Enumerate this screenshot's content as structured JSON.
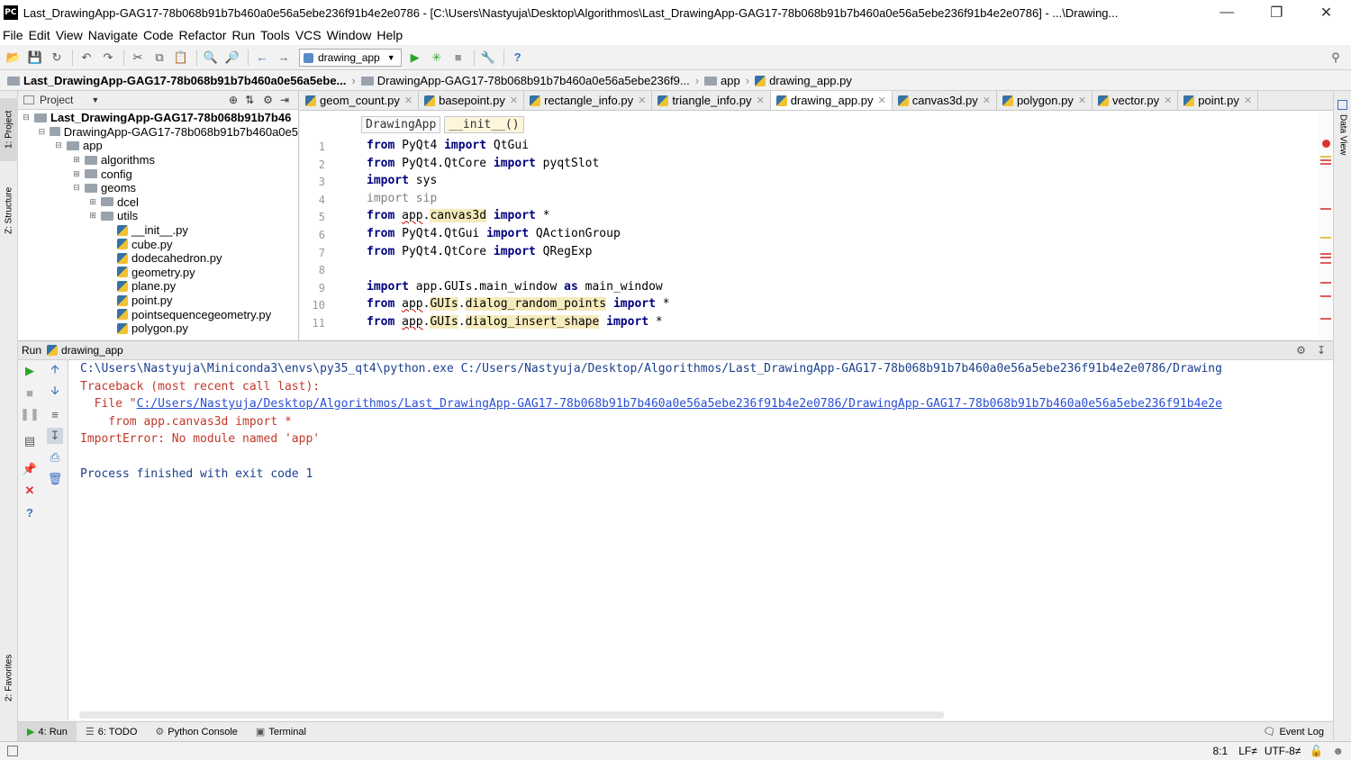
{
  "window": {
    "title": "Last_DrawingApp-GAG17-78b068b91b7b460a0e56a5ebe236f91b4e2e0786 - [C:\\Users\\Nastyuja\\Desktop\\Algorithmos\\Last_DrawingApp-GAG17-78b068b91b7b460a0e56a5ebe236f91b4e2e0786] - ...\\Drawing...",
    "app_icon": "PC"
  },
  "menu": [
    "File",
    "Edit",
    "View",
    "Navigate",
    "Code",
    "Refactor",
    "Run",
    "Tools",
    "VCS",
    "Window",
    "Help"
  ],
  "toolbar": {
    "run_config": "drawing_app"
  },
  "nav_breadcrumbs": [
    "Last_DrawingApp-GAG17-78b068b91b7b460a0e56a5ebe...",
    "DrawingApp-GAG17-78b068b91b7b460a0e56a5ebe236f9...",
    "app",
    "drawing_app.py"
  ],
  "side_tabs": {
    "project": "1: Project",
    "structure": "Z: Structure",
    "favorites": "2: Favorites",
    "data_view": "Data View"
  },
  "project_panel": {
    "header": "Project",
    "tree": [
      {
        "label": "Last_DrawingApp-GAG17-78b068b91b7b46",
        "type": "folder",
        "bold": true
      },
      {
        "label": "DrawingApp-GAG17-78b068b91b7b460a0e5",
        "type": "folder"
      },
      {
        "label": "app",
        "type": "folder"
      },
      {
        "label": "algorithms",
        "type": "folder"
      },
      {
        "label": "config",
        "type": "folder"
      },
      {
        "label": "geoms",
        "type": "folder"
      },
      {
        "label": "dcel",
        "type": "folder"
      },
      {
        "label": "utils",
        "type": "folder"
      },
      {
        "label": "__init__.py",
        "type": "py"
      },
      {
        "label": "cube.py",
        "type": "py"
      },
      {
        "label": "dodecahedron.py",
        "type": "py"
      },
      {
        "label": "geometry.py",
        "type": "py"
      },
      {
        "label": "plane.py",
        "type": "py"
      },
      {
        "label": "point.py",
        "type": "py"
      },
      {
        "label": "pointsequencegeometry.py",
        "type": "py"
      },
      {
        "label": "polygon.py",
        "type": "py"
      }
    ]
  },
  "editor_tabs": [
    {
      "label": "geom_count.py",
      "active": false
    },
    {
      "label": "basepoint.py",
      "active": false
    },
    {
      "label": "rectangle_info.py",
      "active": false
    },
    {
      "label": "triangle_info.py",
      "active": false
    },
    {
      "label": "drawing_app.py",
      "active": true
    },
    {
      "label": "canvas3d.py",
      "active": false
    },
    {
      "label": "polygon.py",
      "active": false
    },
    {
      "label": "vector.py",
      "active": false
    },
    {
      "label": "point.py",
      "active": false
    }
  ],
  "editor_breadcrumb": [
    "DrawingApp",
    "__init__()"
  ],
  "code_lines": [
    {
      "n": "1",
      "t": [
        [
          "kw",
          "from"
        ],
        [
          "",
          " PyQt4 "
        ],
        [
          "kw",
          "import"
        ],
        [
          "",
          " QtGui"
        ]
      ]
    },
    {
      "n": "2",
      "t": [
        [
          "kw",
          "from"
        ],
        [
          "",
          " PyQt4.QtCore "
        ],
        [
          "kw",
          "import"
        ],
        [
          "",
          " pyqtSlot"
        ]
      ]
    },
    {
      "n": "3",
      "t": [
        [
          "kw",
          "import"
        ],
        [
          "",
          " sys"
        ]
      ]
    },
    {
      "n": "4",
      "t": [
        [
          "grey",
          "import sip"
        ]
      ]
    },
    {
      "n": "5",
      "t": [
        [
          "kw",
          "from"
        ],
        [
          "",
          " "
        ],
        [
          "wavy",
          "app"
        ],
        [
          "",
          "."
        ],
        [
          "hlm",
          "canvas3d"
        ],
        [
          "",
          " "
        ],
        [
          "kw",
          "import"
        ],
        [
          "",
          " *"
        ]
      ]
    },
    {
      "n": "6",
      "t": [
        [
          "kw",
          "from"
        ],
        [
          "",
          " PyQt4.QtGui "
        ],
        [
          "kw",
          "import"
        ],
        [
          "",
          " QActionGroup"
        ]
      ]
    },
    {
      "n": "7",
      "t": [
        [
          "kw",
          "from"
        ],
        [
          "",
          " PyQt4.QtCore "
        ],
        [
          "kw",
          "import"
        ],
        [
          "",
          " QRegExp"
        ]
      ]
    },
    {
      "n": "8",
      "t": []
    },
    {
      "n": "9",
      "t": [
        [
          "kw",
          "import"
        ],
        [
          "",
          " app.GUIs.main_window "
        ],
        [
          "kw",
          "as"
        ],
        [
          "",
          " main_window"
        ]
      ]
    },
    {
      "n": "10",
      "t": [
        [
          "kw",
          "from"
        ],
        [
          "",
          " "
        ],
        [
          "wavy",
          "app"
        ],
        [
          "",
          "."
        ],
        [
          "hlm",
          "GUIs"
        ],
        [
          "",
          "."
        ],
        [
          "hlm",
          "dialog_random_points"
        ],
        [
          "",
          " "
        ],
        [
          "kw",
          "import"
        ],
        [
          "",
          " *"
        ]
      ]
    },
    {
      "n": "11",
      "t": [
        [
          "kw",
          "from"
        ],
        [
          "",
          " "
        ],
        [
          "wavy",
          "app"
        ],
        [
          "",
          "."
        ],
        [
          "hlm",
          "GUIs"
        ],
        [
          "",
          "."
        ],
        [
          "hlm",
          "dialog_insert_shape"
        ],
        [
          "",
          " "
        ],
        [
          "kw",
          "import"
        ],
        [
          "",
          " *"
        ]
      ]
    }
  ],
  "run_panel": {
    "label": "Run",
    "config": "drawing_app",
    "console": [
      {
        "cls": "blue",
        "text": "C:\\Users\\Nastyuja\\Miniconda3\\envs\\py35_qt4\\python.exe C:/Users/Nastyuja/Desktop/Algorithmos/Last_DrawingApp-GAG17-78b068b91b7b460a0e56a5ebe236f91b4e2e0786/Drawing"
      },
      {
        "cls": "red",
        "text": "Traceback (most recent call last):"
      },
      {
        "cls": "red",
        "prefix": "  File \"",
        "link": "C:/Users/Nastyuja/Desktop/Algorithmos/Last_DrawingApp-GAG17-78b068b91b7b460a0e56a5ebe236f91b4e2e0786/DrawingApp-GAG17-78b068b91b7b460a0e56a5ebe236f91b4e2e"
      },
      {
        "cls": "red",
        "text": "    from app.canvas3d import *"
      },
      {
        "cls": "red",
        "text": "ImportError: No module named 'app'"
      },
      {
        "cls": "",
        "text": ""
      },
      {
        "cls": "blue",
        "text": "Process finished with exit code 1"
      }
    ]
  },
  "bottom_tabs": [
    {
      "label": "4: Run",
      "active": true,
      "icon": "run-icon"
    },
    {
      "label": "6: TODO",
      "active": false,
      "icon": "todo-icon"
    },
    {
      "label": "Python Console",
      "active": false,
      "icon": "python-console-icon"
    },
    {
      "label": "Terminal",
      "active": false,
      "icon": "terminal-icon"
    }
  ],
  "event_log": "Event Log",
  "status": {
    "position": "8:1",
    "line_sep": "LF≠",
    "encoding": "UTF-8≠"
  },
  "colors": {
    "keyword": "#000080",
    "error": "#c0392b",
    "link": "#2a4fd6",
    "highlight": "#f6ebbc"
  }
}
